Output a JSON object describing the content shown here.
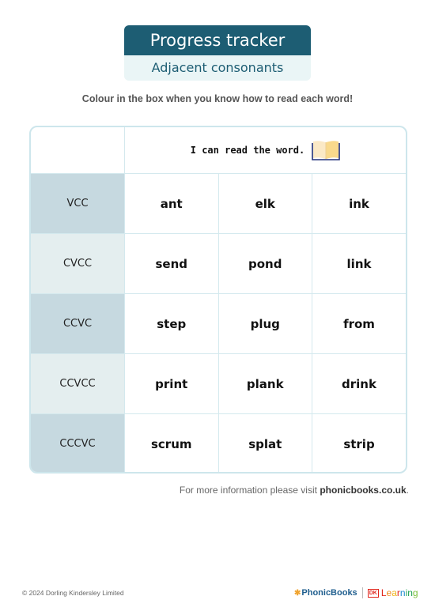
{
  "header": {
    "title": "Progress tracker",
    "subtitle": "Adjacent consonants"
  },
  "instruction": "Colour in the box when you know how to read each word!",
  "table": {
    "header_label": "I can read the word.",
    "header_icon": "open-book-icon",
    "rows": [
      {
        "pattern": "VCC",
        "words": [
          "ant",
          "elk",
          "ink"
        ]
      },
      {
        "pattern": "CVCC",
        "words": [
          "send",
          "pond",
          "link"
        ]
      },
      {
        "pattern": "CCVC",
        "words": [
          "step",
          "plug",
          "from"
        ]
      },
      {
        "pattern": "CCVCC",
        "words": [
          "print",
          "plank",
          "drink"
        ]
      },
      {
        "pattern": "CCCVC",
        "words": [
          "scrum",
          "splat",
          "strip"
        ]
      }
    ]
  },
  "footer": {
    "more_info_prefix": "For more information please visit ",
    "more_info_link": "phonicbooks.co.uk",
    "more_info_suffix": ".",
    "copyright": "© 2024 Dorling Kindersley Limited",
    "logo_phonicbooks": "PhonicBooks",
    "logo_dk": "DK",
    "logo_learning": "Learning"
  },
  "colors": {
    "title_bg": "#1d5d73",
    "subtitle_bg": "#eaf5f6",
    "row_dark": "#c6d9e0",
    "row_light": "#e4eeef",
    "border": "#cde6ec"
  }
}
